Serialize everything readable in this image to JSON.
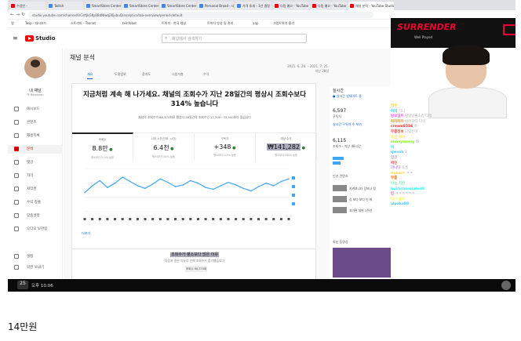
{
  "browser": {
    "tabs": [
      {
        "label": "수업반 -",
        "active": false
      },
      {
        "label": "Twitch",
        "active": false
      },
      {
        "label": "SmartStore Center - 네이",
        "active": false
      },
      {
        "label": "SmartStore Center - 네이",
        "active": false
      },
      {
        "label": "SmartStore Center - 네이",
        "active": false
      },
      {
        "label": "Personal Broad - 네이버",
        "active": false
      },
      {
        "label": "가격 추세 - 1년 결정 결정",
        "active": false
      },
      {
        "label": "다림 예고 - YouTube",
        "active": false
      },
      {
        "label": "다림 예고 - YouTube",
        "active": false
      },
      {
        "label": "채널 분석 - YouTube Studio",
        "active": true
      }
    ],
    "url": "studio.youtube.com/channel/UCstfjkGKy8BdNlwq2KjvbuQ/analytics/tab-overview/period-default",
    "bookmarks": [
      "앱",
      "Twip - 대시보드",
      "스트리머 - Toonat",
      "tvinfobot",
      "트위치 - 한국 채널",
      "트위치 방송 및 관리",
      "yap",
      "그랩트위치 올리"
    ]
  },
  "studio": {
    "logo_text": "Studio",
    "search_placeholder": "채널에서 검색하기",
    "channel_name": "내 채널",
    "channel_sub": "박 Bowdown",
    "sidebar": [
      {
        "label": "대시보드",
        "active": false
      },
      {
        "label": "콘텐츠",
        "active": false
      },
      {
        "label": "재생목록",
        "active": false
      },
      {
        "label": "분석",
        "active": true
      },
      {
        "label": "댓글",
        "active": false
      },
      {
        "label": "자막",
        "active": false
      },
      {
        "label": "저작권",
        "active": false
      },
      {
        "label": "수익 창출",
        "active": false
      },
      {
        "label": "맞춤설정",
        "active": false
      },
      {
        "label": "오디오 보관함",
        "active": false
      }
    ],
    "sidebar_bottom": [
      {
        "label": "설정"
      },
      {
        "label": "의견 보내기"
      }
    ],
    "page_title": "채널 분석",
    "tabs": [
      "개요",
      "도달범위",
      "참여도",
      "시청자층",
      "수익"
    ],
    "date_range": "2021. 6. 28. – 2021. 7. 25.",
    "date_label": "지난 28일",
    "headline": "지금처럼 계속 해 나가세요. 채널의 조회수가 지난 28일간의 평상시 조회수보다 314% 높습니다",
    "subline": "채널의 조회수가 66,374회로 평상시 28일간의 조회수인 12,700~33,900보다 많습니다",
    "metrics": [
      {
        "label": "조회수",
        "value": "8.8만",
        "sub": "평소보다 214% 높음",
        "selected": true
      },
      {
        "label": "시청 시간(단위: 시간)",
        "value": "6.4천",
        "sub": "평소보다 100% 높음",
        "selected": false
      },
      {
        "label": "구독자",
        "value": "+348",
        "sub": "평소보다 115% 높음",
        "selected": false
      },
      {
        "label": "예상 수익",
        "value": "₩141,282",
        "sub": "평소보다 185% 높음",
        "selected": false
      }
    ],
    "see_more": "더보기",
    "lower_title": "조회수가 평소보다 많은 이유",
    "lower_sub": "다음과 같은 이유로 인해 조회수가 증가했습니다",
    "lower_button": "조회수 66,374회",
    "realtime_title": "실시간",
    "realtime_sub": "● 실시간 업데이트 중",
    "realtime_subs": "6,597",
    "realtime_subs_label": "구독자",
    "realtime_link": "실시간 구독자 수 보기",
    "realtime_views": "6,115",
    "realtime_views_label": "조회수 · 지난 48시간",
    "top_content": "인기 콘텐츠",
    "top_videos": [
      "지켜보니다 당보나 정",
      "감 보다 보다 인 비",
      "과거편 데뷔 1주년"
    ],
    "latest": "최신 동영상"
  },
  "stream": {
    "banner_title": "SURRENDER",
    "banner_sub": "Well Played",
    "chat": [
      {
        "name": "히쿠",
        "text": "",
        "color": "#ffd700"
      },
      {
        "name": "아지",
        "text": "기니",
        "color": "#00e5ff"
      },
      {
        "name": "당보일트",
        "text": "당일날좋소감 다의",
        "color": "#ff4dff"
      },
      {
        "name": "하하하하",
        "text": "바라크타 다이",
        "color": "#ff8c00"
      },
      {
        "name": "creamS556",
        "text": "야",
        "color": "#ff2222"
      },
      {
        "name": "무릎정보",
        "text": "다있는어",
        "color": "#ff4444"
      },
      {
        "name": "무산 다이",
        "text": "",
        "color": "#ffeb3b"
      },
      {
        "name": "sunnysunny",
        "text": "와",
        "color": "#7cfc00"
      },
      {
        "name": "어",
        "text": "",
        "color": "#00ffff"
      },
      {
        "name": "qwosh",
        "text": "1",
        "color": "#4fc3f7"
      },
      {
        "name": "인코",
        "text": "",
        "color": "#aaa"
      },
      {
        "name": "배민",
        "text": "",
        "color": "#ff5252"
      },
      {
        "name": "가나다",
        "text": "호흡",
        "color": "#b388ff"
      },
      {
        "name": "nqndnt",
        "text": "ㅋㅋ",
        "color": "#ffd740"
      },
      {
        "name": "무릎",
        "text": "",
        "color": "#ff6d00"
      },
      {
        "name": "나는 치킨",
        "text": "",
        "color": "#69f0ae"
      },
      {
        "name": "hushchocolate29",
        "text": "",
        "color": "#18ffff"
      },
      {
        "name": "인",
        "text": "ㅋㅋㅋㅋㅋㅋ",
        "color": "#ff4081"
      },
      {
        "name": "다스 슬라",
        "text": "",
        "color": "#eeff41"
      },
      {
        "name": "alpaka88",
        "text": "",
        "color": "#40c4ff"
      }
    ]
  },
  "overlay": {
    "count": "25",
    "clock": "오후 10:06"
  },
  "caption": "14만원",
  "chart_data": {
    "type": "line",
    "series": [
      {
        "values": [
          22,
          30,
          36,
          28,
          33,
          40,
          35,
          30,
          27,
          32,
          38,
          34,
          29,
          31,
          36,
          33,
          28,
          26,
          30,
          34,
          31,
          27,
          24,
          29,
          33,
          30,
          35,
          38
        ]
      }
    ],
    "ylim": [
      0,
      50
    ]
  }
}
